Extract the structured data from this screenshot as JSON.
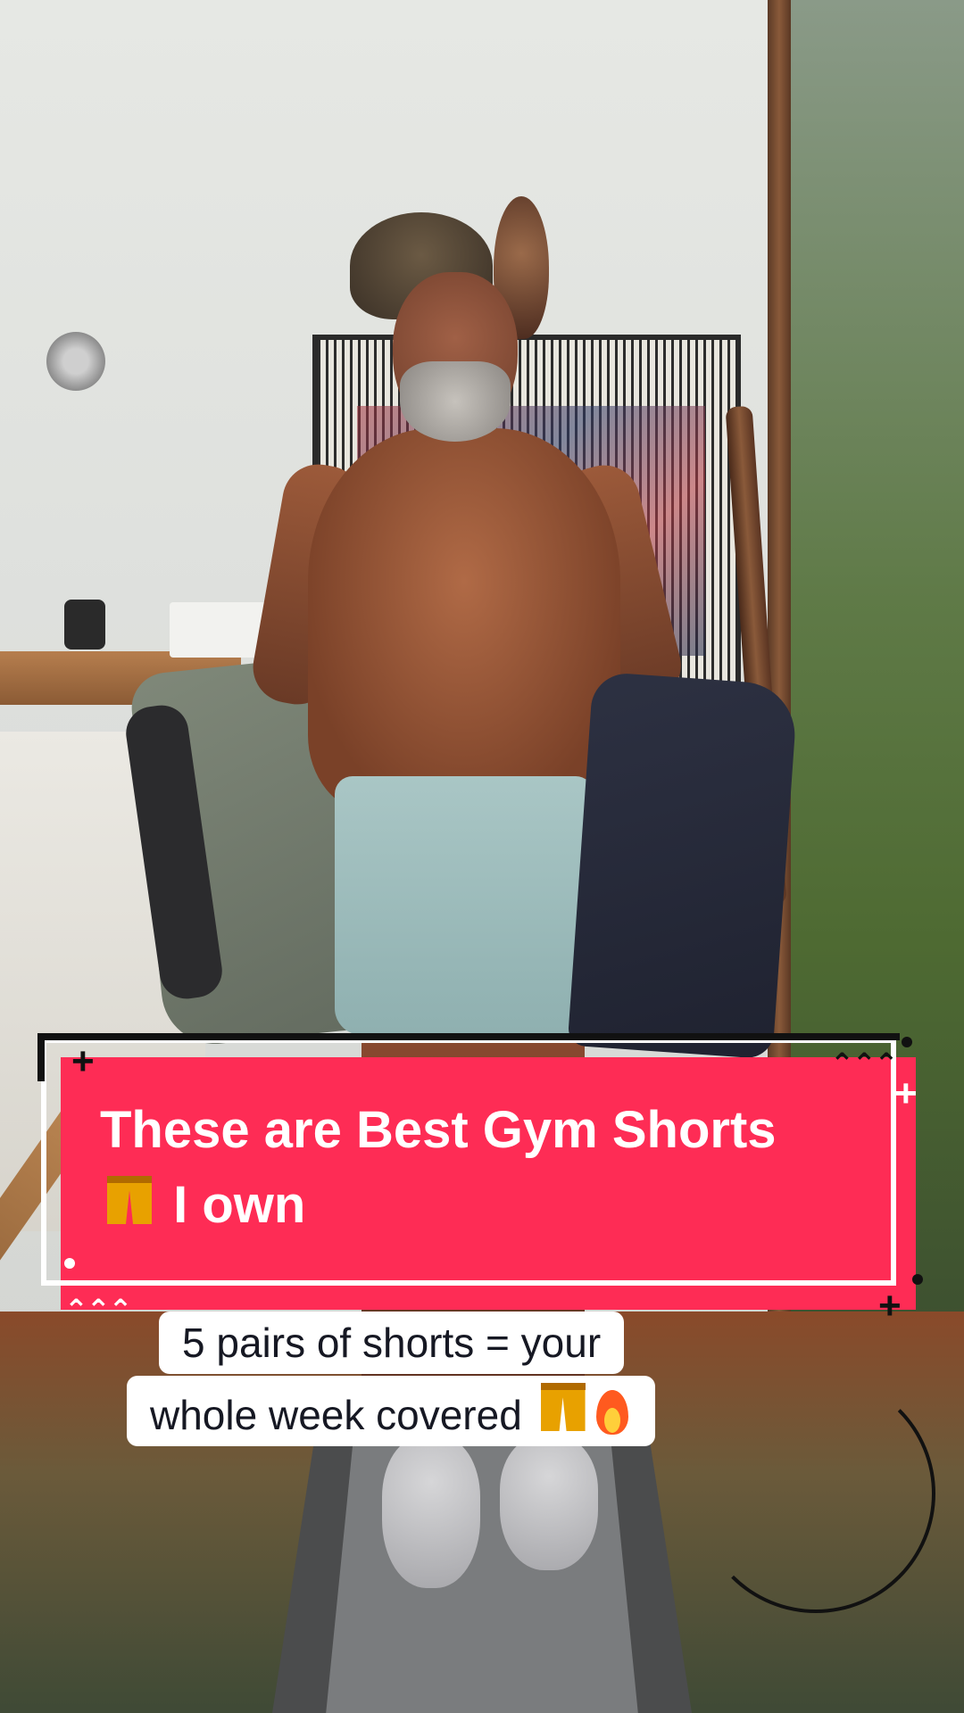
{
  "title_card": {
    "line1": "These are Best Gym Shorts",
    "line2": "I own",
    "emoji_icon": "shorts-emoji-icon",
    "background_color": "#fe2c55",
    "text_color": "#ffffff"
  },
  "caption": {
    "line1": "5 pairs of shorts = your",
    "line2": "whole week covered",
    "emojis": [
      "shorts-emoji-icon",
      "fire-emoji-icon"
    ],
    "background_color": "#ffffff",
    "text_color": "#161823"
  }
}
